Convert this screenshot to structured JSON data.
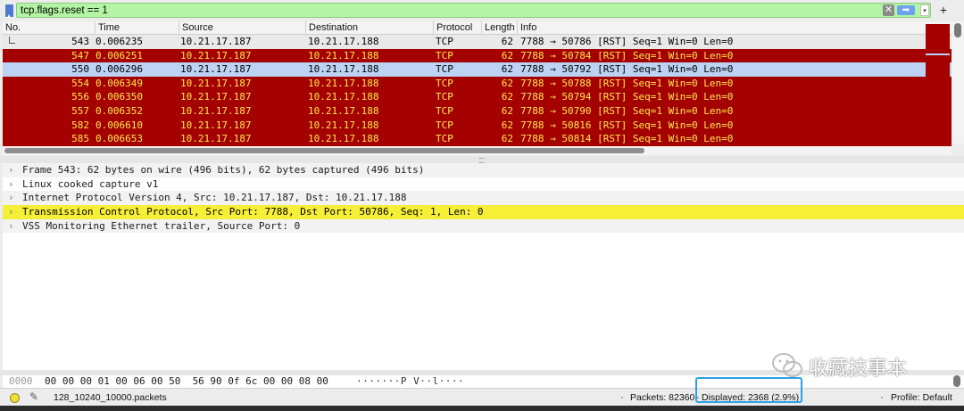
{
  "filter": {
    "value": "tcp.flags.reset == 1",
    "clear_glyph": "✕",
    "apply_glyph": "➡",
    "history_glyph": "▾",
    "add_glyph": "+"
  },
  "packet_list": {
    "columns": [
      "No.",
      "Time",
      "Source",
      "Destination",
      "Protocol",
      "Length",
      "Info"
    ],
    "rows": [
      {
        "no": "543",
        "time": "0.006235",
        "src": "10.21.17.187",
        "dst": "10.21.17.188",
        "proto": "TCP",
        "len": "62",
        "info": "7788 → 50786 [RST] Seq=1 Win=0 Len=0",
        "style": "plain"
      },
      {
        "no": "547",
        "time": "0.006251",
        "src": "10.21.17.187",
        "dst": "10.21.17.188",
        "proto": "TCP",
        "len": "62",
        "info": "7788 → 50784 [RST] Seq=1 Win=0 Len=0",
        "style": "rst"
      },
      {
        "no": "550",
        "time": "0.006296",
        "src": "10.21.17.187",
        "dst": "10.21.17.188",
        "proto": "TCP",
        "len": "62",
        "info": "7788 → 50792 [RST] Seq=1 Win=0 Len=0",
        "style": "selected"
      },
      {
        "no": "554",
        "time": "0.006349",
        "src": "10.21.17.187",
        "dst": "10.21.17.188",
        "proto": "TCP",
        "len": "62",
        "info": "7788 → 50788 [RST] Seq=1 Win=0 Len=0",
        "style": "rst"
      },
      {
        "no": "556",
        "time": "0.006350",
        "src": "10.21.17.187",
        "dst": "10.21.17.188",
        "proto": "TCP",
        "len": "62",
        "info": "7788 → 50794 [RST] Seq=1 Win=0 Len=0",
        "style": "rst"
      },
      {
        "no": "557",
        "time": "0.006352",
        "src": "10.21.17.187",
        "dst": "10.21.17.188",
        "proto": "TCP",
        "len": "62",
        "info": "7788 → 50790 [RST] Seq=1 Win=0 Len=0",
        "style": "rst"
      },
      {
        "no": "582",
        "time": "0.006610",
        "src": "10.21.17.187",
        "dst": "10.21.17.188",
        "proto": "TCP",
        "len": "62",
        "info": "7788 → 50816 [RST] Seq=1 Win=0 Len=0",
        "style": "rst"
      },
      {
        "no": "585",
        "time": "0.006653",
        "src": "10.21.17.187",
        "dst": "10.21.17.188",
        "proto": "TCP",
        "len": "62",
        "info": "7788 → 50814 [RST] Seq=1 Win=0 Len=0",
        "style": "rst"
      }
    ]
  },
  "details": [
    {
      "text": "Frame 543: 62 bytes on wire (496 bits), 62 bytes captured (496 bits)",
      "style": "alt"
    },
    {
      "text": "Linux cooked capture v1",
      "style": ""
    },
    {
      "text": "Internet Protocol Version 4, Src: 10.21.17.187, Dst: 10.21.17.188",
      "style": "alt"
    },
    {
      "text": "Transmission Control Protocol, Src Port: 7788, Dst Port: 50786, Seq: 1, Len: 0",
      "style": "hl"
    },
    {
      "text": "VSS Monitoring Ethernet trailer, Source Port: 0",
      "style": "alt"
    }
  ],
  "bytes": {
    "offset": "0000",
    "hex": "00 00 00 01 00 06 00 50  56 90 0f 6c 00 00 08 00",
    "ascii": "·······P V··l····"
  },
  "watermark": {
    "text": "收藏技事本"
  },
  "status": {
    "file": "128_10240_10000.packets",
    "packets": "Packets: 82360",
    "displayed": "Displayed: 2368 (2.9%)",
    "profile": "Profile: Default"
  },
  "colors": {
    "filter_valid": "#b3f5a4",
    "rst_row_bg": "#a40000",
    "rst_row_fg": "#fce94f",
    "selected_row": "#bcd3f3",
    "detail_highlight": "#f5ef38",
    "callout_border": "#2aa0ea"
  }
}
